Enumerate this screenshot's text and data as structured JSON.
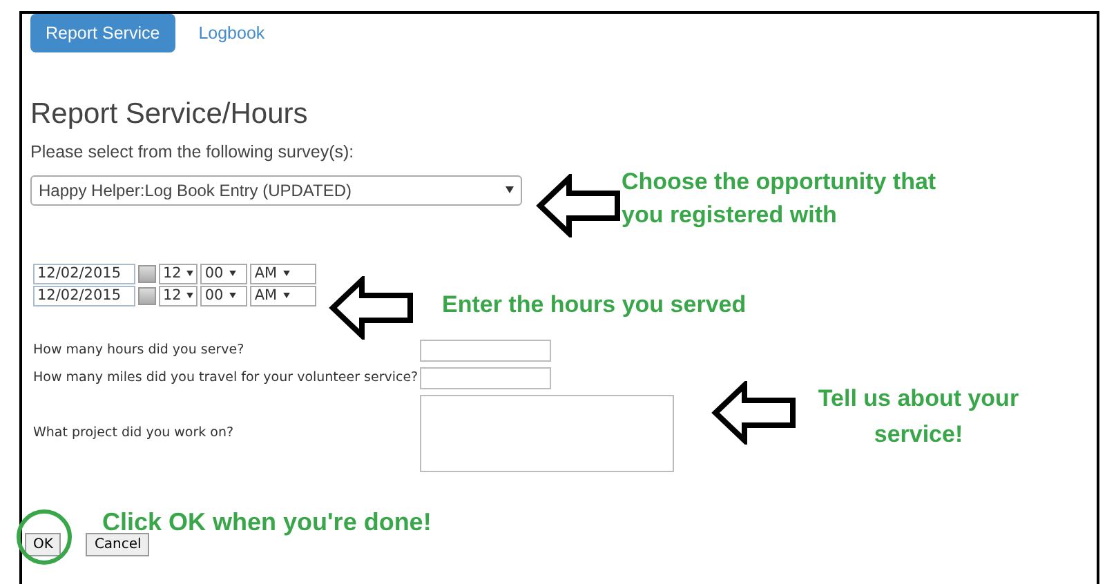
{
  "tabs": [
    {
      "label": "Report Service",
      "selected": true
    },
    {
      "label": "Logbook",
      "selected": false
    }
  ],
  "heading": "Report Service/Hours",
  "prompt": "Please select from the following survey(s):",
  "survey_select": {
    "value": "Happy Helper:Log Book Entry (UPDATED)"
  },
  "date_rows": [
    {
      "date": "12/02/2015",
      "hour": "12",
      "minute": "00",
      "period": "AM"
    },
    {
      "date": "12/02/2015",
      "hour": "12",
      "minute": "00",
      "period": "AM"
    }
  ],
  "questions": [
    {
      "label": "How many hours did you serve?",
      "kind": "input"
    },
    {
      "label": "How many miles did you travel for your volunteer service?",
      "kind": "input"
    },
    {
      "label": "What project did you work on?",
      "kind": "textarea"
    }
  ],
  "buttons": [
    {
      "label": "OK",
      "circled": true
    },
    {
      "label": "Cancel",
      "circled": false
    }
  ],
  "annotations": [
    {
      "text": "Choose the opportunity that you registered with",
      "arrow": true
    },
    {
      "text": "Enter the hours you served",
      "arrow": true
    },
    {
      "text": "Tell us about your service!",
      "arrow": true
    },
    {
      "text": "Click OK when you're done!",
      "arrow": false
    }
  ]
}
